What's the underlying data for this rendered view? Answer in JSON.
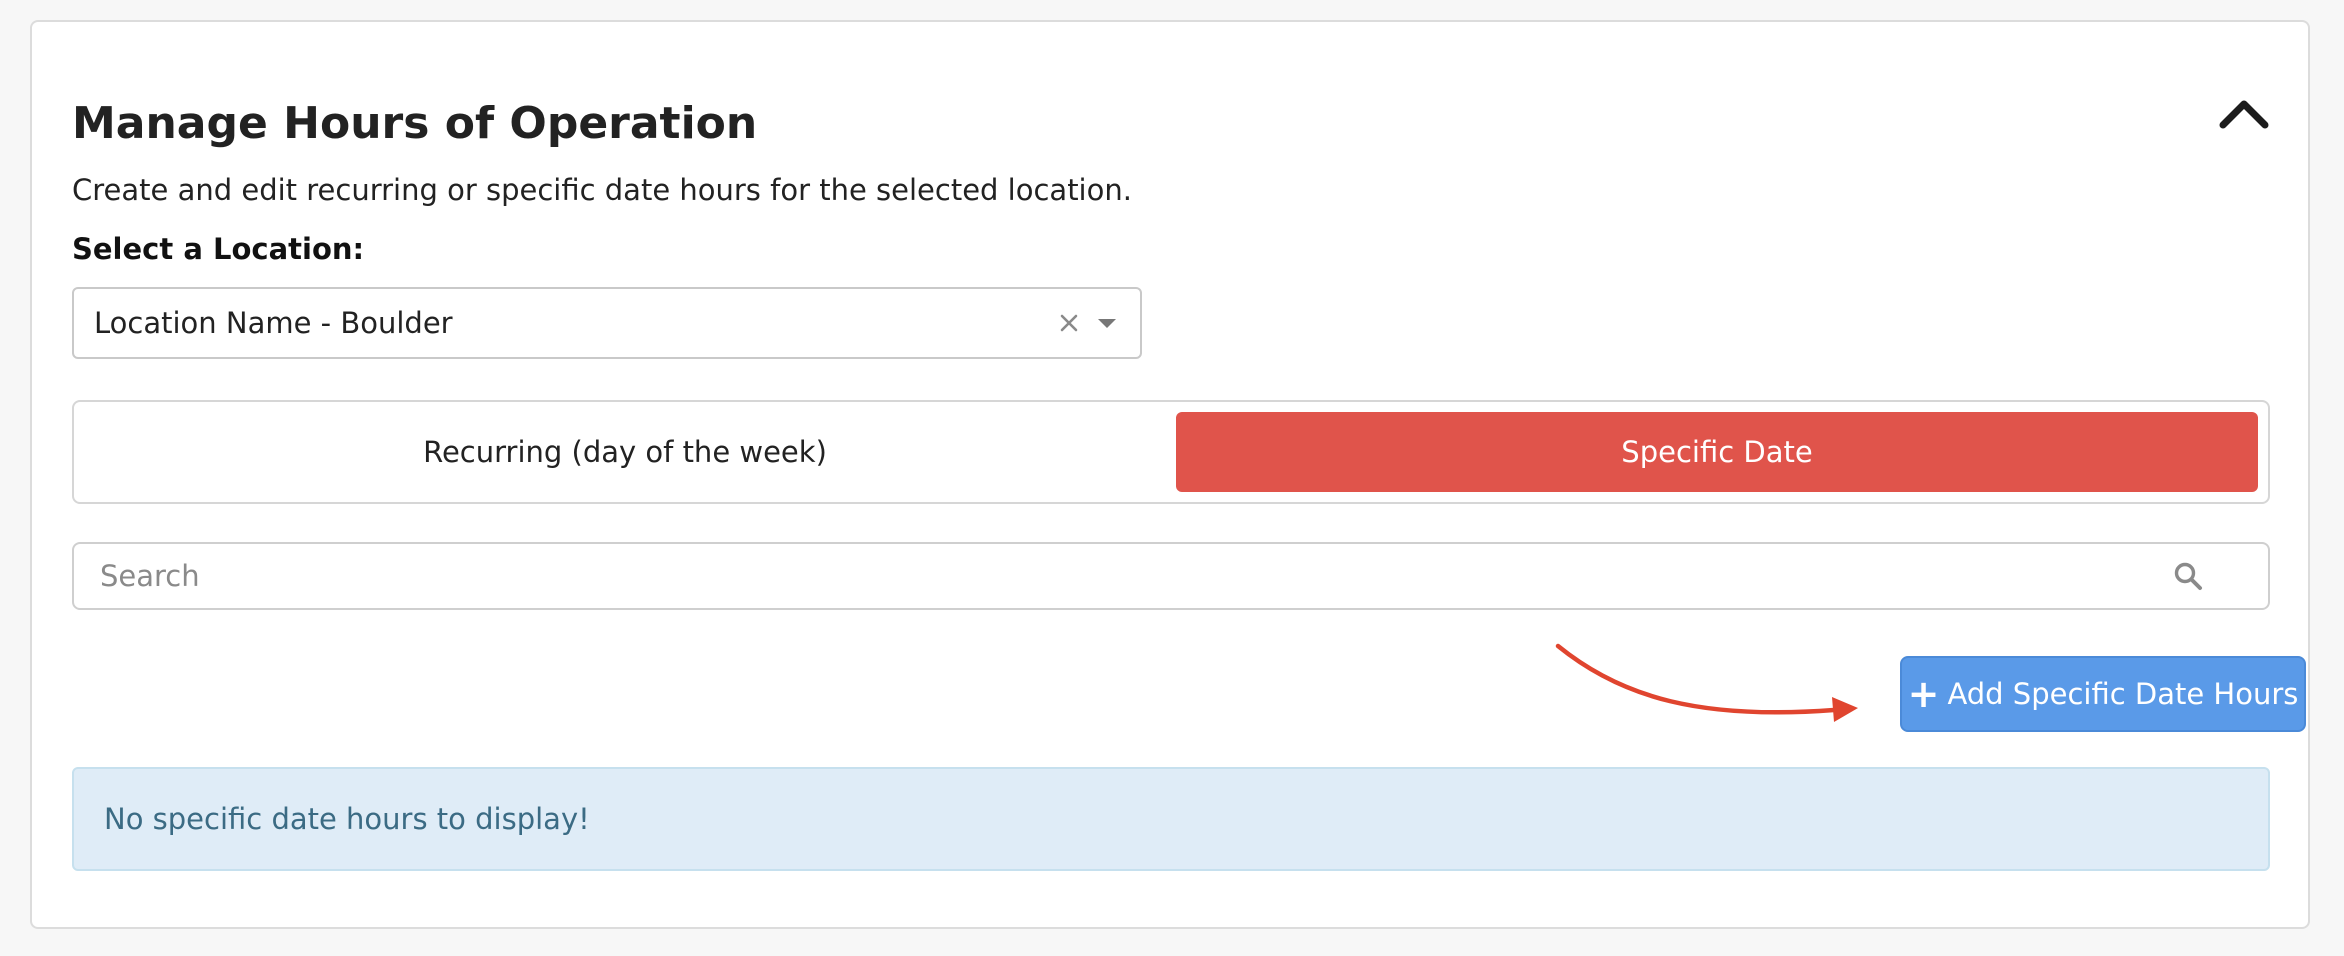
{
  "panel": {
    "title": "Manage Hours of Operation",
    "subtitle": "Create and edit recurring or specific date hours for the selected location."
  },
  "location": {
    "label": "Select a Location:",
    "selected": "Location Name - Boulder"
  },
  "tabs": [
    {
      "label": "Recurring (day of the week)",
      "active": false
    },
    {
      "label": "Specific Date",
      "active": true
    }
  ],
  "search": {
    "placeholder": "Search"
  },
  "actions": {
    "add_label": "Add Specific Date Hours"
  },
  "empty_state": {
    "message": "No specific date hours to display!"
  },
  "icons": {
    "collapse": "chevron-up-icon",
    "clear": "close-icon",
    "dropdown": "caret-down-icon",
    "search": "search-icon",
    "add": "plus-icon",
    "annotation": "arrow-icon"
  },
  "colors": {
    "active_tab": "#e0544b",
    "primary_button": "#5a9ae8",
    "info_background": "#dfecf7",
    "info_text": "#3b6b84",
    "annotation_arrow": "#e0452f"
  }
}
